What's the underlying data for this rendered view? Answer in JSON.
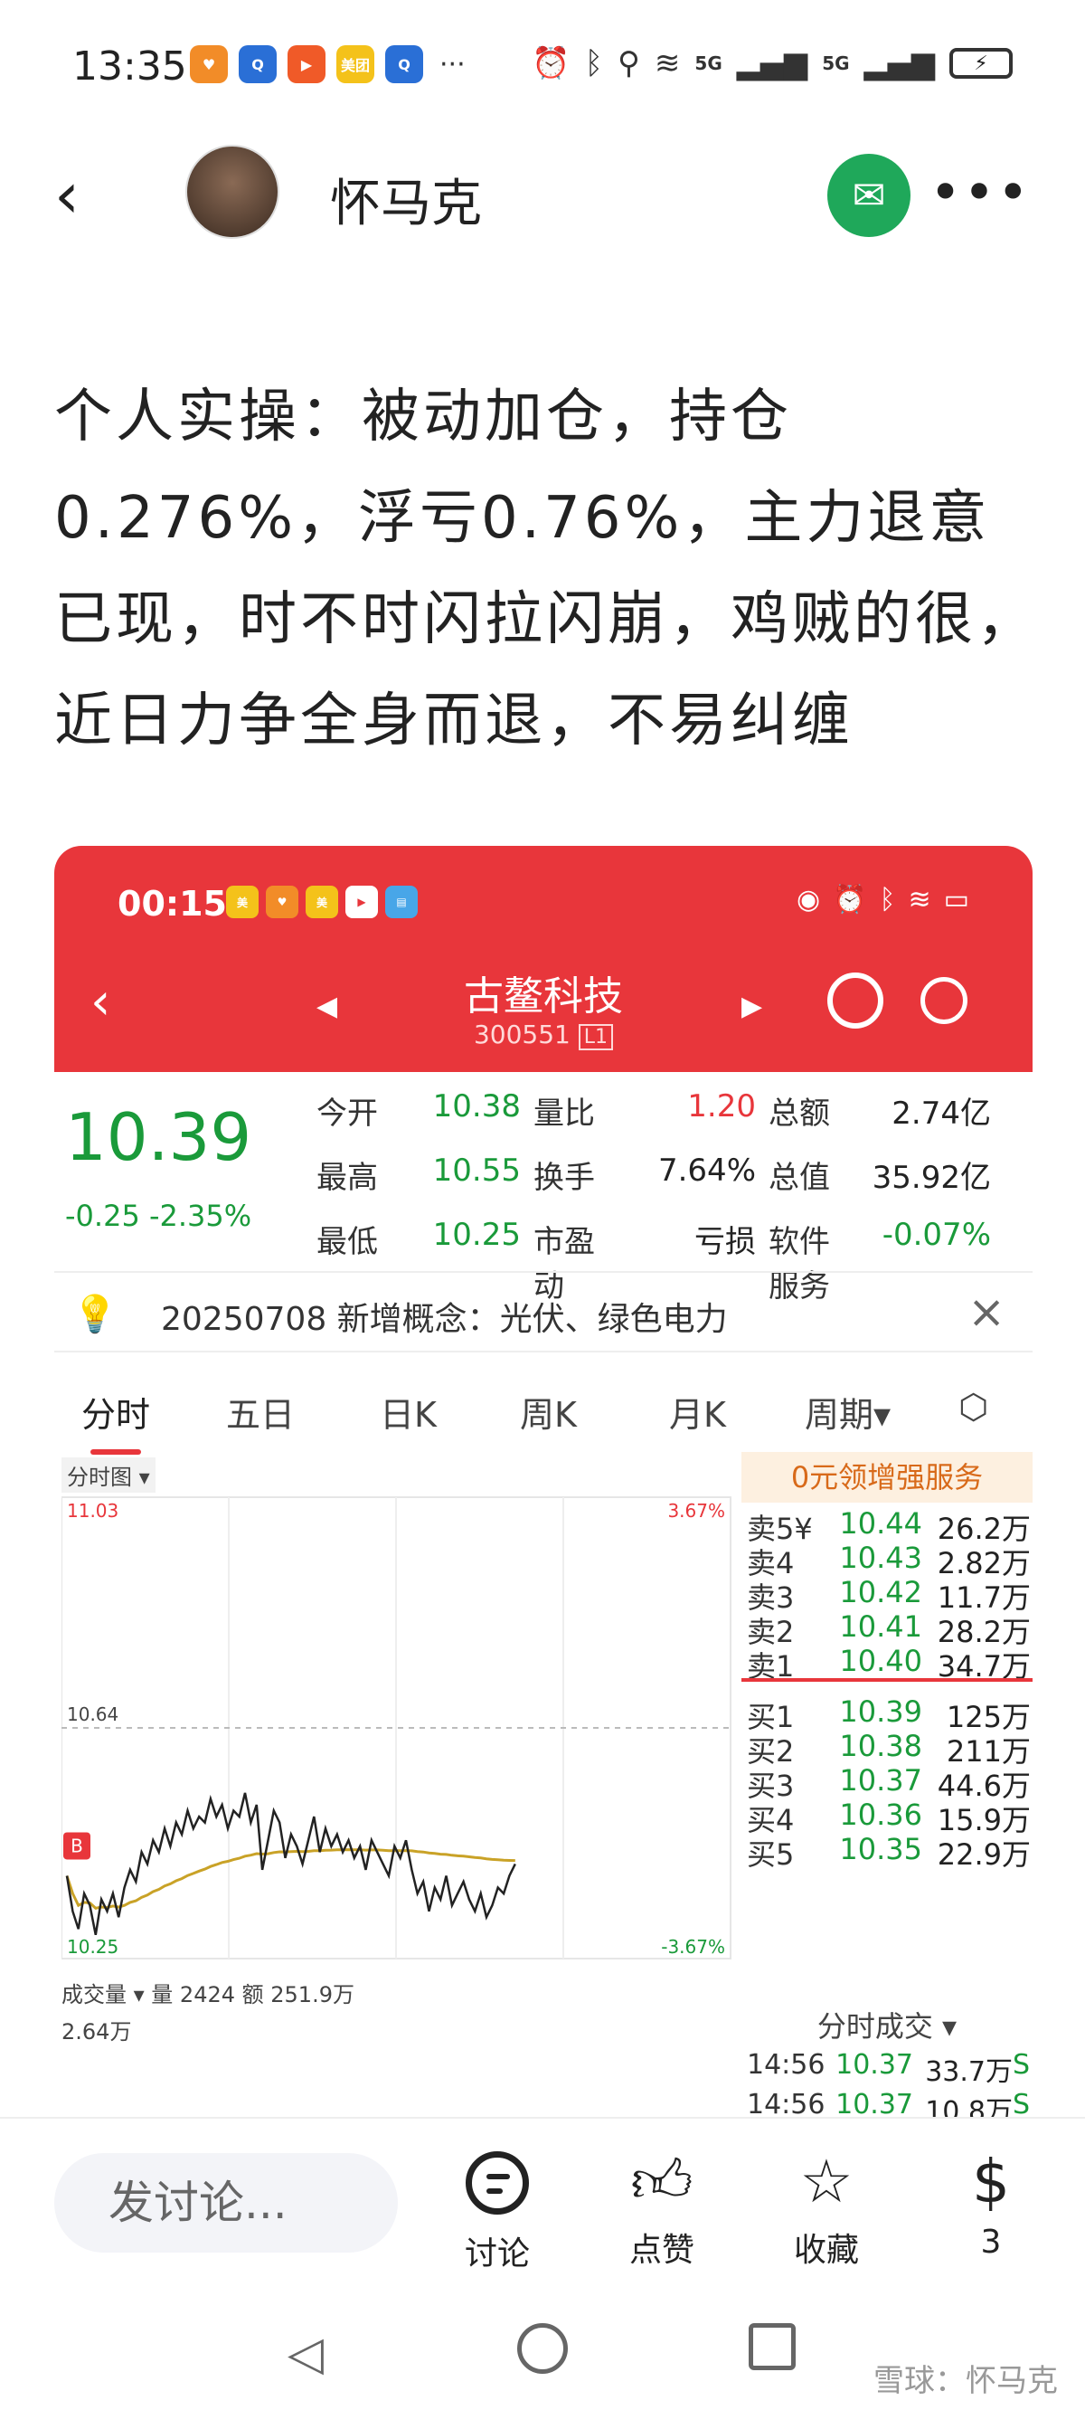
{
  "status_bar": {
    "time": "13:35",
    "apps": [
      {
        "name": "heart-app-icon",
        "color": "#f28c28",
        "label": "♥"
      },
      {
        "name": "search-app-icon",
        "color": "#2a6fd6",
        "label": "Q"
      },
      {
        "name": "video-app-icon",
        "color": "#f05a28",
        "label": "▶"
      },
      {
        "name": "meituan-app-icon",
        "color": "#f4c21a",
        "label": "美团"
      },
      {
        "name": "search2-app-icon",
        "color": "#2a6fd6",
        "label": "Q"
      }
    ],
    "more": "···",
    "network_1": "5G",
    "network_2": "5G"
  },
  "header": {
    "author": "怀马克"
  },
  "article": {
    "paragraph": "个人实操：被动加仓，持仓0.276%，浮亏0.76%，主力退意已现，时不时闪拉闪崩，鸡贼的很，近日力争全身而退，不易纠缠"
  },
  "embedded": {
    "status_time": "00:15",
    "stock_name": "古鳌科技",
    "stock_code": "300551",
    "code_badge": "L1",
    "price": "10.39",
    "change": "-0.25 -2.35%",
    "quote_grid": [
      {
        "label": "今开",
        "value": "10.38",
        "cls": "grn"
      },
      {
        "label": "量比",
        "value": "1.20",
        "cls": "red"
      },
      {
        "label": "总额",
        "value": "2.74亿",
        "cls": "blk"
      },
      {
        "label": "最高",
        "value": "10.55",
        "cls": "grn"
      },
      {
        "label": "换手",
        "value": "7.64%",
        "cls": "blk"
      },
      {
        "label": "总值",
        "value": "35.92亿",
        "cls": "blk"
      },
      {
        "label": "最低",
        "value": "10.25",
        "cls": "grn"
      },
      {
        "label": "市盈动",
        "value": "亏损",
        "cls": "blk"
      },
      {
        "label": "软件服务",
        "value": "-0.07%",
        "cls": "grn"
      }
    ],
    "concept": "20250708 新增概念：光伏、绿色电力",
    "tabs": [
      "分时",
      "五日",
      "日K",
      "周K",
      "月K",
      "周期▾"
    ],
    "chart_title": "分时图 ▾",
    "chart_labels": {
      "top_left": "11.03",
      "top_right": "3.67%",
      "mid_left": "10.64",
      "bottom_left": "10.25",
      "bottom_right": "-3.67%",
      "marker": "B"
    },
    "volume_header": "成交量 ▾   量 2424   额 251.9万",
    "volume_axis": "2.64万",
    "promo": "0元领增强服务",
    "asks": [
      {
        "label": "卖5¥",
        "price": "10.44",
        "vol": "26.2万"
      },
      {
        "label": "卖4",
        "price": "10.43",
        "vol": "2.82万"
      },
      {
        "label": "卖3",
        "price": "10.42",
        "vol": "11.7万"
      },
      {
        "label": "卖2",
        "price": "10.41",
        "vol": "28.2万"
      },
      {
        "label": "卖1",
        "price": "10.40",
        "vol": "34.7万"
      }
    ],
    "bids": [
      {
        "label": "买1",
        "price": "10.39",
        "vol": "125万"
      },
      {
        "label": "买2",
        "price": "10.38",
        "vol": "211万"
      },
      {
        "label": "买3",
        "price": "10.37",
        "vol": "44.6万"
      },
      {
        "label": "买4",
        "price": "10.36",
        "vol": "15.9万"
      },
      {
        "label": "买5",
        "price": "10.35",
        "vol": "22.9万"
      }
    ],
    "trades_title": "分时成交 ▾",
    "trades": [
      {
        "time": "14:56",
        "price": "10.37",
        "vol": "33.7万",
        "side": "S"
      },
      {
        "time": "14:56",
        "price": "10.37",
        "vol": "10.8万",
        "side": "S"
      }
    ],
    "intraday_prices": [
      10.39,
      10.33,
      10.3,
      10.36,
      10.34,
      10.29,
      10.35,
      10.33,
      10.36,
      10.32,
      10.37,
      10.4,
      10.38,
      10.43,
      10.41,
      10.45,
      10.43,
      10.47,
      10.44,
      10.48,
      10.46,
      10.5,
      10.47,
      10.49,
      10.48,
      10.52,
      10.49,
      10.51,
      10.47,
      10.5,
      10.49,
      10.53,
      10.48,
      10.51,
      10.4,
      10.45,
      10.5,
      10.48,
      10.42,
      10.46,
      10.44,
      10.41,
      10.45,
      10.49,
      10.43,
      10.47,
      10.44,
      10.46,
      10.43,
      10.45,
      10.42,
      10.44,
      10.4,
      10.45,
      10.43,
      10.41,
      10.39,
      10.44,
      10.42,
      10.45,
      10.4,
      10.36,
      10.38,
      10.33,
      10.37,
      10.35,
      10.39,
      10.34,
      10.36,
      10.38,
      10.35,
      10.33,
      10.36,
      10.32,
      10.34,
      10.37,
      10.36,
      10.39,
      10.41
    ]
  },
  "actionbar": {
    "input_placeholder": "发讨论...",
    "discuss": "讨论",
    "like": "点赞",
    "favorite": "收藏",
    "reward_count": "3"
  },
  "navbar": {
    "watermark": "雪球：怀马克"
  }
}
